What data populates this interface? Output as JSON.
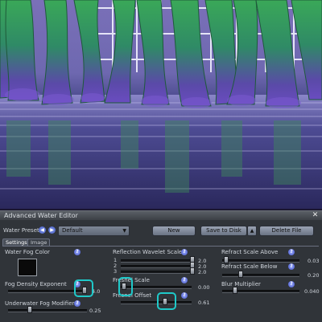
{
  "window": {
    "title": "Advanced Water Editor"
  },
  "presets": {
    "label": "Water Presets:",
    "selected": "Default",
    "buttons": {
      "new": "New",
      "save": "Save to Disk",
      "delete": "Delete File"
    }
  },
  "tabs": [
    {
      "label": "Settings",
      "active": true
    },
    {
      "label": "Image",
      "active": false
    }
  ],
  "settings": {
    "fog_color": {
      "label": "Water Fog Color",
      "color": "#0a0a0a"
    },
    "fog_density": {
      "label": "Fog Density Exponent",
      "value": "4.0"
    },
    "underwater_fog": {
      "label": "Underwater Fog Modifier",
      "value": "0.25"
    },
    "wavelet": {
      "label": "Reflection Wavelet Scale",
      "rows": [
        {
          "index": "1",
          "value": "2.0"
        },
        {
          "index": "2",
          "value": "2.0"
        },
        {
          "index": "3",
          "value": "2.0"
        }
      ]
    },
    "fresnel_scale": {
      "label": "Fresnel Scale",
      "value": "0.00"
    },
    "fresnel_offset": {
      "label": "Fresnel Offset",
      "value": "0.61"
    },
    "refract_above": {
      "label": "Refract Scale Above",
      "value": "0.03"
    },
    "refract_below": {
      "label": "Refract Scale Below",
      "value": "0.20"
    },
    "blur": {
      "label": "Blur Multiplier",
      "value": "0.040"
    }
  },
  "help_symbol": "?",
  "icons": {
    "close": "✕",
    "arrow_left": "◀",
    "arrow_right": "▶",
    "spin_up": "▲",
    "caret_down": "▼"
  },
  "colors": {
    "marker": "#1fc9c9",
    "panel": "#303439"
  }
}
